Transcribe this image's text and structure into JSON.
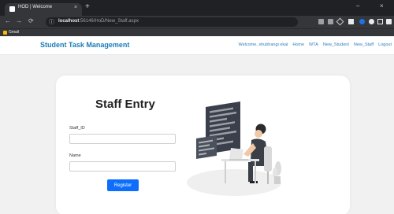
{
  "browser": {
    "tab_title": "HOD | Welcome",
    "tab_close": "×",
    "new_tab": "+",
    "url_host": "localhost",
    "url_path": ":56146/HoD/New_Staff.aspx",
    "bookmark_label": "Gmail",
    "window_minimize": "–",
    "window_close": "×"
  },
  "app": {
    "brand": "Student Task Management",
    "nav": {
      "welcome": "Welcome, shubhangi ekal",
      "home": "Home",
      "wta": "WTA",
      "new_student": "New_Student",
      "new_staff": "New_Staff",
      "logout": "Logout"
    }
  },
  "form": {
    "title": "Staff Entry",
    "staff_id_label": "Staff_ID",
    "staff_id_value": "",
    "name_label": "Name",
    "name_value": "",
    "register_label": "Register"
  },
  "icons": {
    "back": "back-arrow-icon",
    "forward": "forward-arrow-icon",
    "reload": "reload-icon",
    "site_info": "site-info-icon"
  },
  "colors": {
    "brand": "#1a7bb5",
    "nav_link": "#2a7fc1",
    "button": "#0d6efd",
    "page_bg": "#f1f1f2"
  }
}
